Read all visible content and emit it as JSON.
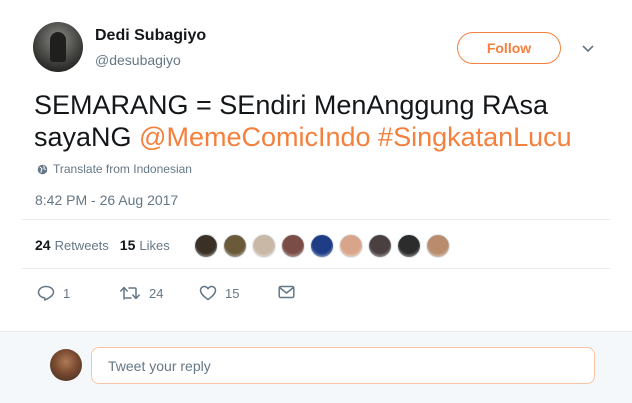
{
  "author": {
    "name": "Dedi Subagiyo",
    "handle": "@desubagiyo"
  },
  "follow_label": "Follow",
  "tweet": {
    "text_line1": "SEMARANG = SEndiri MenAnggung RAsa",
    "text_line2_prefix": "sayaNG ",
    "mention": "@MemeComicIndo",
    "hashtag": "#SingkatanLucu",
    "translate": "Translate from Indonesian",
    "timestamp": "8:42 PM - 26 Aug 2017"
  },
  "stats": {
    "retweets_count": "24",
    "retweets_label": "Retweets",
    "likes_count": "15",
    "likes_label": "Likes"
  },
  "liker_avatars": [
    {
      "color": "#3b3026"
    },
    {
      "color": "#6b5a3a"
    },
    {
      "color": "#c9b8a6"
    },
    {
      "color": "#7a4d46"
    },
    {
      "color": "#1f3d86"
    },
    {
      "color": "#d8a58a"
    },
    {
      "color": "#4a4040"
    },
    {
      "color": "#2c2c2c"
    },
    {
      "color": "#b88c6c"
    }
  ],
  "actions": {
    "reply_count": "1",
    "retweet_count": "24",
    "like_count": "15"
  },
  "reply": {
    "placeholder": "Tweet your reply"
  },
  "colors": {
    "accent": "#f5803e",
    "muted": "#657786"
  }
}
